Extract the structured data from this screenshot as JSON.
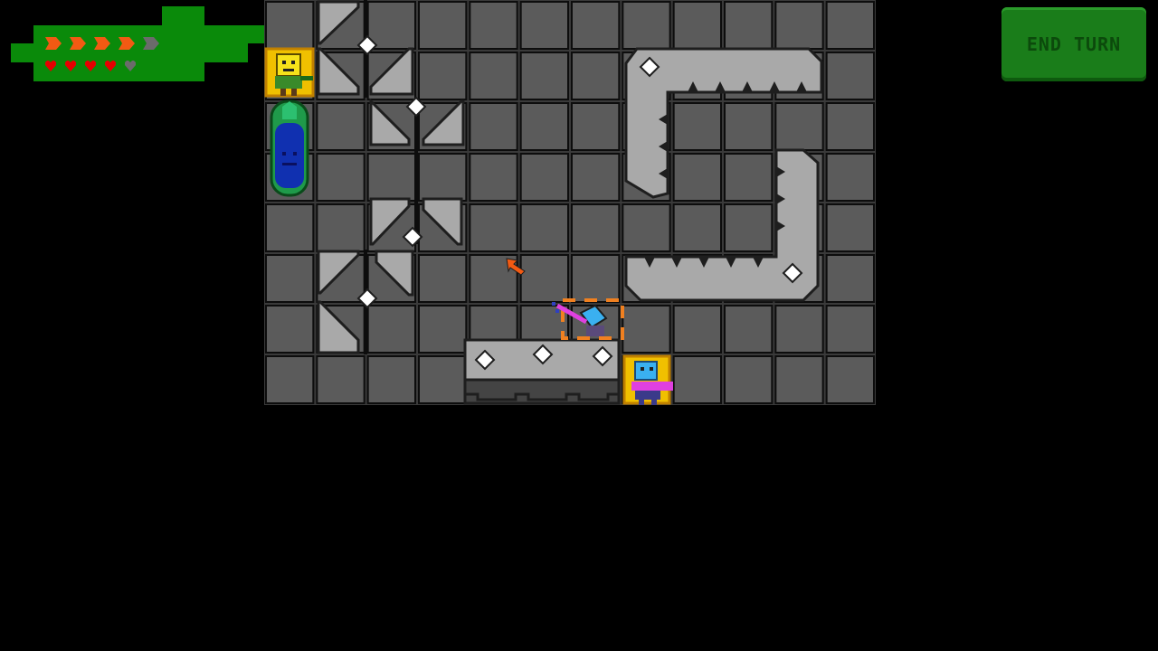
{
  "hud": {
    "energy": {
      "filled": 4,
      "total": 5,
      "color": "#f25a13",
      "empty_color": "#6b6b6b",
      "icon": "energy-arrow-icon"
    },
    "health": {
      "filled": 4,
      "total": 5,
      "color": "#e60000",
      "empty_color": "#6b6b6b",
      "icon": "heart-icon"
    },
    "panel_color": "#0a8a0a"
  },
  "end_turn": {
    "label": "END TURN",
    "color": "#1a7d1a"
  },
  "board": {
    "rows": 8,
    "cols": 12,
    "tile_color": "#5b5b5b",
    "grid_color": "#0d0d0d",
    "units": [
      {
        "name": "yellow-hero",
        "color": "#f0c000"
      },
      {
        "name": "blue-hero",
        "color": "#3ab0f0"
      },
      {
        "name": "green-capsule",
        "color": "#1f9a4a"
      }
    ],
    "cursor_icon": "pointer-arrow-icon"
  },
  "colors": {
    "wall": "#a9a9a9",
    "wall_dark": "#2a2a2a",
    "gem": "#ffffff",
    "selection": "#f08020",
    "beam": "#e040e0"
  }
}
